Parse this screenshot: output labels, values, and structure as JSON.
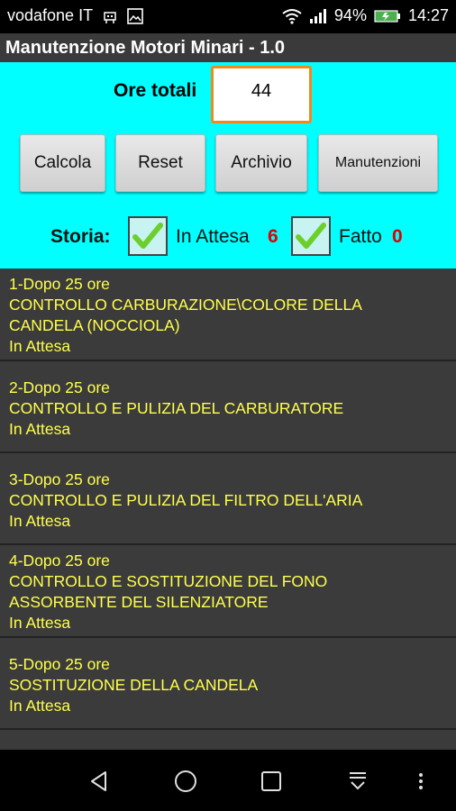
{
  "status_bar": {
    "carrier": "vodafone IT",
    "battery": "94%",
    "time": "14:27"
  },
  "title": "Manutenzione Motori Minari - 1.0",
  "form": {
    "ore_label": "Ore totali",
    "ore_value": "44"
  },
  "buttons": {
    "calcola": "Calcola",
    "reset": "Reset",
    "archivio": "Archivio",
    "manutenzioni": "Manutenzioni"
  },
  "storia": {
    "label": "Storia:",
    "in_attesa_label": "In Attesa",
    "in_attesa_count": "6",
    "fatto_label": "Fatto",
    "fatto_count": "0",
    "in_attesa_checked": true,
    "fatto_checked": true
  },
  "items": [
    {
      "header": "1-Dopo 25 ore",
      "desc1": "CONTROLLO CARBURAZIONE\\COLORE DELLA",
      "desc2": "CANDELA (NOCCIOLA)",
      "status": "In Attesa"
    },
    {
      "header": "2-Dopo 25 ore",
      "desc1": "CONTROLLO E PULIZIA DEL CARBURATORE",
      "desc2": "",
      "status": "In Attesa"
    },
    {
      "header": "3-Dopo 25 ore",
      "desc1": "CONTROLLO E PULIZIA DEL FILTRO DELL'ARIA",
      "desc2": "",
      "status": "In Attesa"
    },
    {
      "header": "4-Dopo 25 ore",
      "desc1": "CONTROLLO E SOSTITUZIONE DEL FONO",
      "desc2": "ASSORBENTE DEL SILENZIATORE",
      "status": "In Attesa"
    },
    {
      "header": "5-Dopo 25 ore",
      "desc1": "SOSTITUZIONE DELLA CANDELA",
      "desc2": "",
      "status": "In Attesa"
    }
  ],
  "colors": {
    "controls_bg": "#00ffff",
    "list_bg": "#3b3b3b",
    "item_text": "#ffff4d",
    "count_red": "#e00000",
    "input_border": "#f08a1d"
  },
  "icons": {
    "status": [
      "usb-icon",
      "image-icon",
      "wifi-icon",
      "signal-icon",
      "battery-icon"
    ],
    "nav": [
      "back-icon",
      "home-icon",
      "recents-icon",
      "notification-pull-icon",
      "more-icon"
    ],
    "checkbox": "checkmark-icon"
  }
}
